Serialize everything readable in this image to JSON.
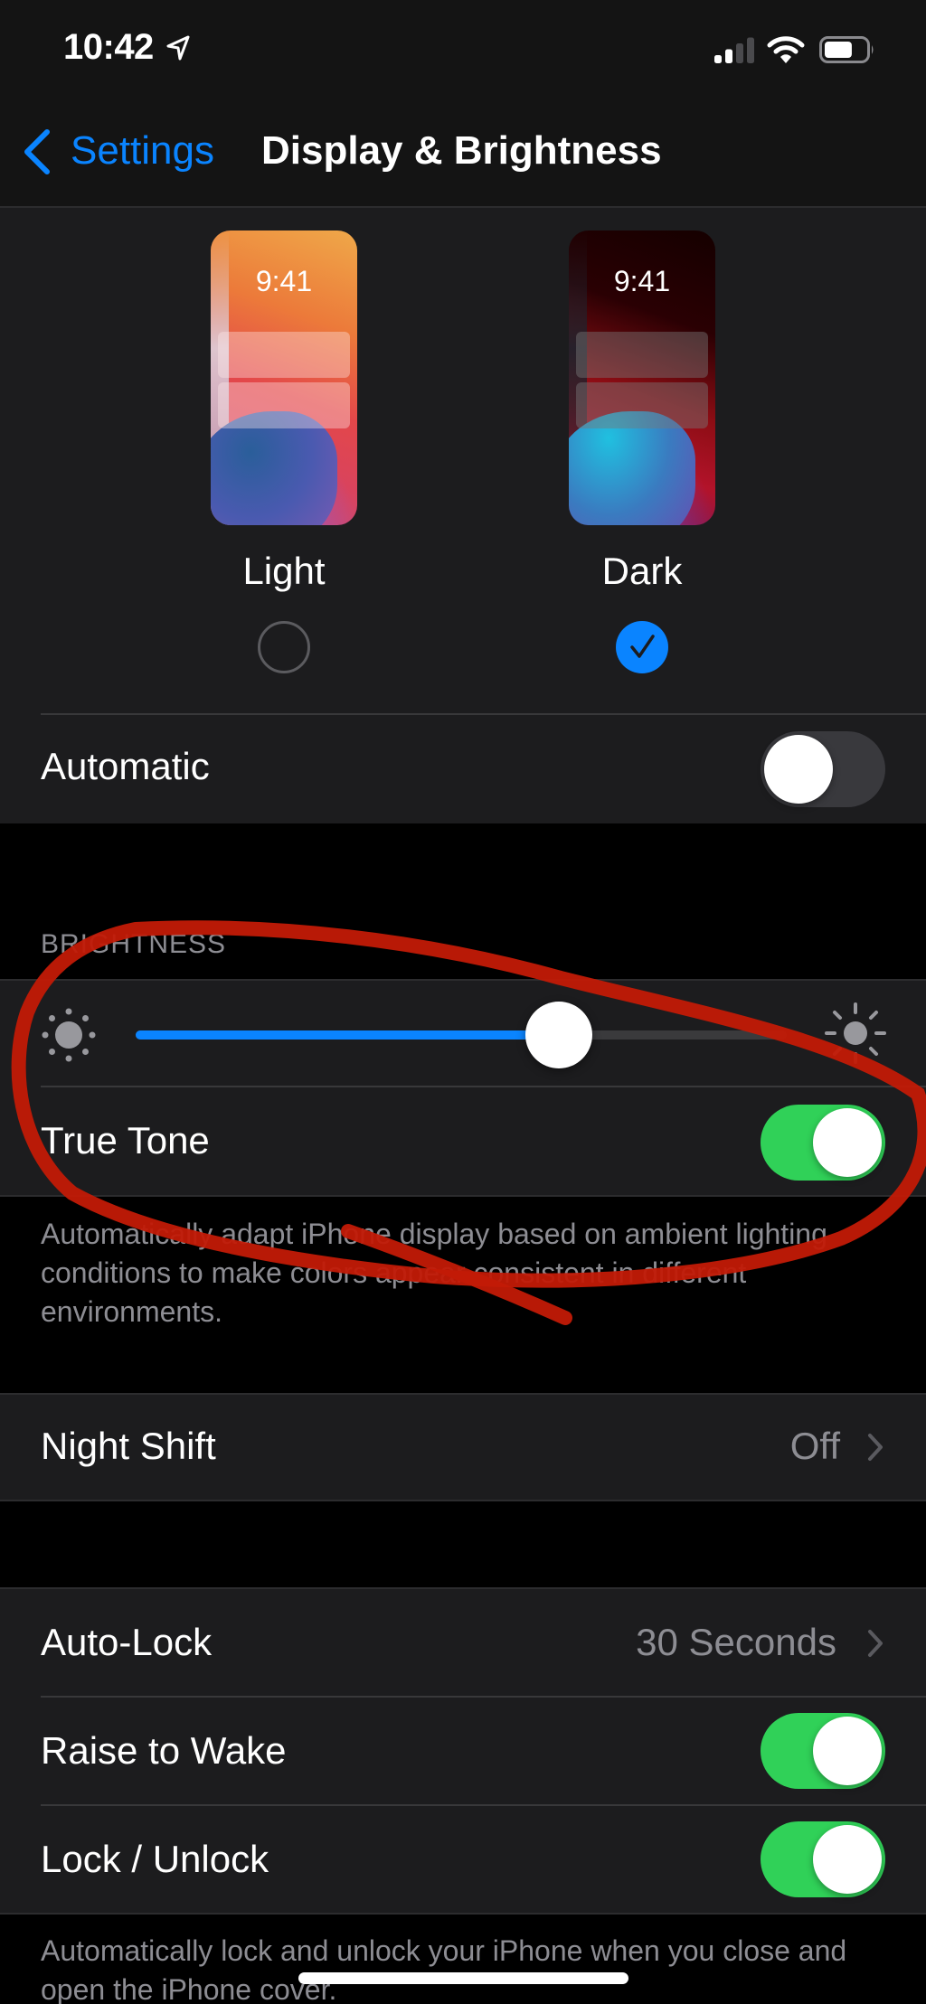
{
  "status_bar": {
    "time": "10:42",
    "location_icon": "location-arrow-icon",
    "signal_bars_filled": 2,
    "signal_bars_total": 4,
    "wifi_icon": "wifi-icon",
    "battery_level": 0.68
  },
  "nav": {
    "back_label": "Settings",
    "back_icon": "chevron-left-icon",
    "title": "Display & Brightness"
  },
  "appearance": {
    "light": {
      "label": "Light",
      "preview_time": "9:41",
      "selected": false
    },
    "dark": {
      "label": "Dark",
      "preview_time": "9:41",
      "selected": true
    },
    "automatic": {
      "label": "Automatic",
      "on": false
    }
  },
  "brightness": {
    "header": "BRIGHTNESS",
    "level": 0.65,
    "min_icon": "sun-dim-icon",
    "max_icon": "sun-bright-icon",
    "true_tone": {
      "label": "True Tone",
      "on": true
    },
    "footnote": "Automatically adapt iPhone display based on ambient lighting conditions to make colors appear consistent in different environments."
  },
  "night_shift": {
    "label": "Night Shift",
    "value": "Off"
  },
  "lock": {
    "auto_lock": {
      "label": "Auto-Lock",
      "value": "30 Seconds"
    },
    "raise_to_wake": {
      "label": "Raise to Wake",
      "on": true
    },
    "lock_unlock": {
      "label": "Lock / Unlock",
      "on": true
    },
    "footnote": "Automatically lock and unlock your iPhone when you close and open the iPhone cover."
  },
  "colors": {
    "accent": "#0a84ff",
    "toggle_on": "#30d158",
    "annotation": "#c21a06"
  }
}
